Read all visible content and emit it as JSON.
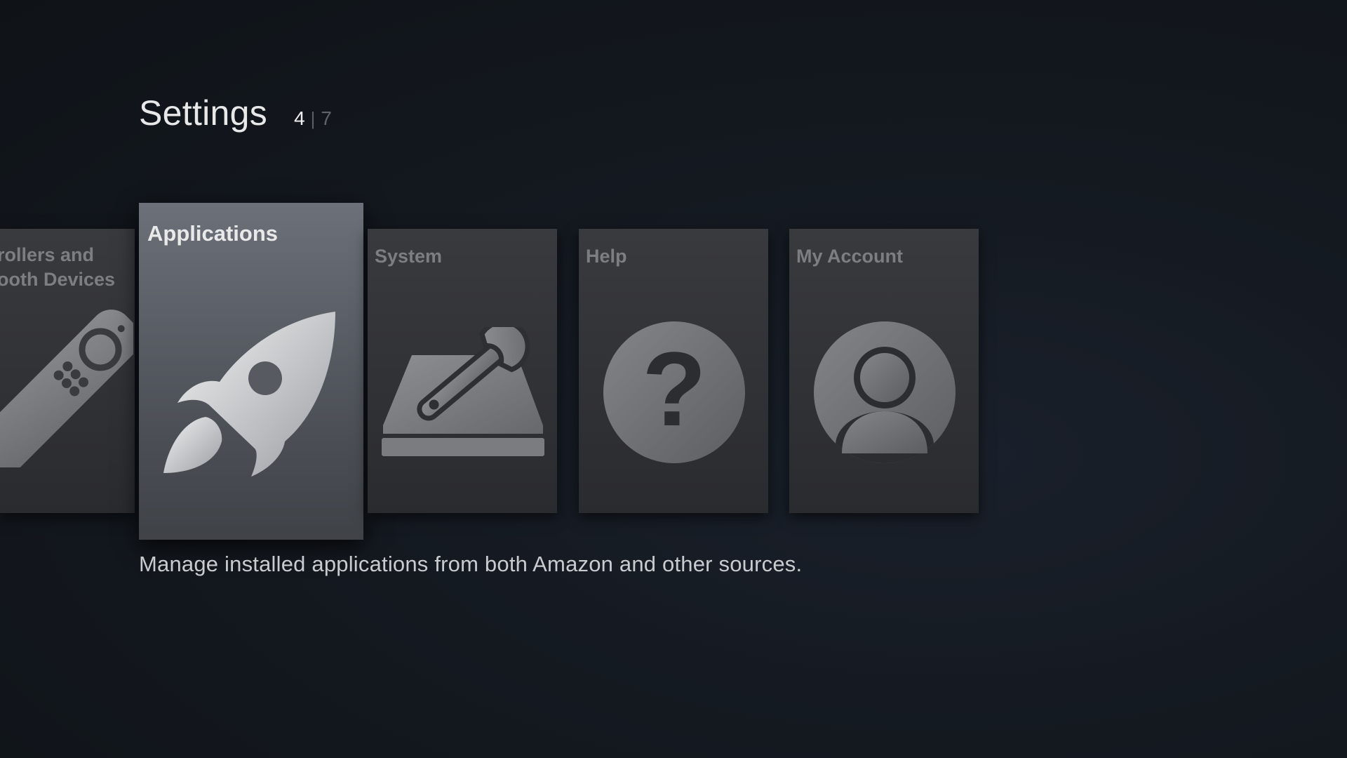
{
  "header": {
    "title": "Settings",
    "pager": {
      "current": "4",
      "separator": "|",
      "total": "7"
    }
  },
  "tiles": [
    {
      "label_line1": "rollers and",
      "label_line2": "ooth Devices",
      "icon": "remote-icon",
      "focused": false
    },
    {
      "label": "Applications",
      "icon": "rocket-icon",
      "focused": true
    },
    {
      "label": "System",
      "icon": "wrench-device-icon",
      "focused": false
    },
    {
      "label": "Help",
      "icon": "question-icon",
      "focused": false
    },
    {
      "label": "My Account",
      "icon": "user-icon",
      "focused": false
    }
  ],
  "description": "Manage installed applications from both Amazon and other sources.",
  "colors": {
    "focused_tile": "#5f636a",
    "tile": "#323336",
    "background": "#141920"
  }
}
